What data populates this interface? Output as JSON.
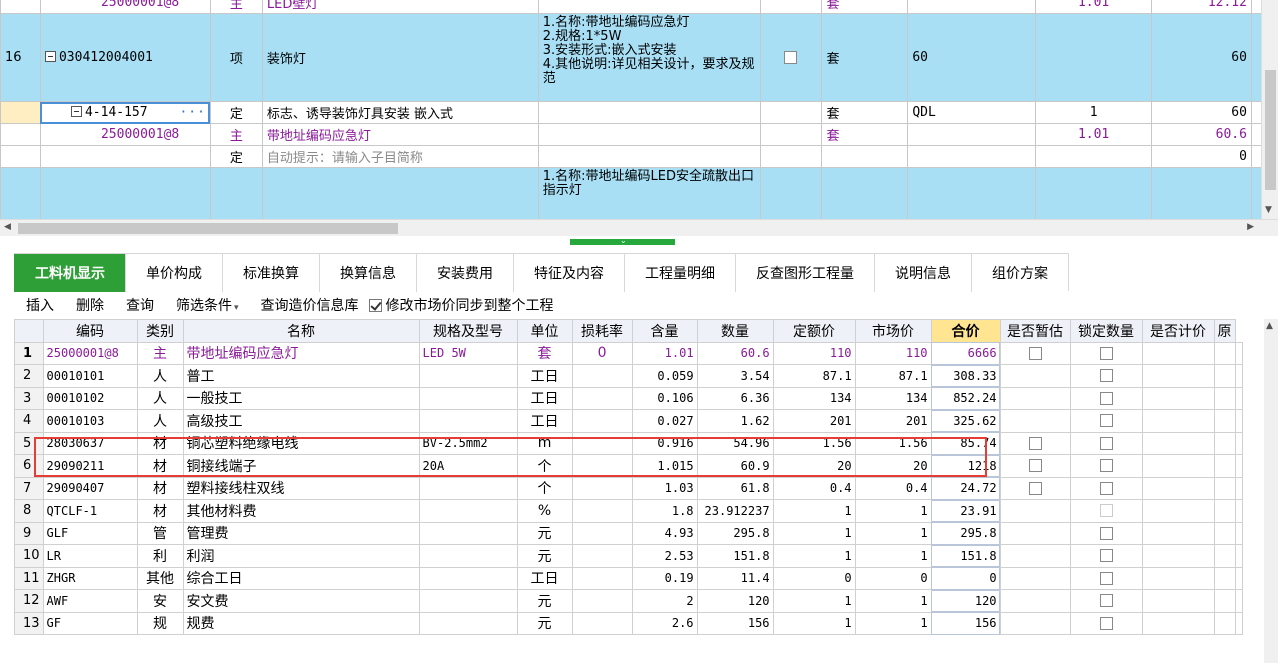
{
  "top_grid": {
    "rows": [
      {
        "rownum": "",
        "code": "25000001@8",
        "type": "主",
        "name": "LED壁灯",
        "features": "",
        "unit": "套",
        "qty_expr": "",
        "qty": "1.01",
        "price": "12.12"
      },
      {
        "rownum": "16",
        "code": "030412004001",
        "type": "项",
        "name": "装饰灯",
        "features": "1.名称:带地址编码应急灯\n2.规格:1*5W\n3.安装形式:嵌入式安装\n4.其他说明:详见相关设计，要求及规范",
        "unit": "套",
        "qty_expr": "60",
        "qty": "",
        "price": "60"
      },
      {
        "rownum": "",
        "code": "4-14-157",
        "type": "定",
        "name": "标志、诱导装饰灯具安装 嵌入式",
        "features": "",
        "unit": "套",
        "qty_expr": "QDL",
        "qty": "1",
        "price": "60"
      },
      {
        "rownum": "",
        "code": "25000001@8",
        "type": "主",
        "name": "带地址编码应急灯",
        "features": "",
        "unit": "套",
        "qty_expr": "",
        "qty": "1.01",
        "price": "60.6"
      },
      {
        "rownum": "",
        "code": "",
        "type": "定",
        "name": "自动提示：请输入子目简称",
        "features": "",
        "unit": "",
        "qty_expr": "",
        "qty": "",
        "price": "0"
      },
      {
        "rownum": "",
        "code": "",
        "type": "",
        "name": "",
        "features": "1.名称:带地址编码LED安全疏散出口指示灯",
        "unit": "",
        "qty_expr": "",
        "qty": "",
        "price": ""
      }
    ]
  },
  "tabs": [
    {
      "label": "工料机显示",
      "active": true
    },
    {
      "label": "单价构成"
    },
    {
      "label": "标准换算"
    },
    {
      "label": "换算信息"
    },
    {
      "label": "安装费用"
    },
    {
      "label": "特征及内容"
    },
    {
      "label": "工程量明细"
    },
    {
      "label": "反查图形工程量"
    },
    {
      "label": "说明信息"
    },
    {
      "label": "组价方案"
    }
  ],
  "toolbar": {
    "insert": "插入",
    "delete": "删除",
    "query": "查询",
    "filter": "筛选条件",
    "price_lib": "查询造价信息库",
    "sync_label": "修改市场价同步到整个工程"
  },
  "bottom_grid": {
    "headers": [
      "编码",
      "类别",
      "名称",
      "规格及型号",
      "单位",
      "损耗率",
      "含量",
      "数量",
      "定额价",
      "市场价",
      "合价",
      "是否暂估",
      "锁定数量",
      "是否计价",
      "原"
    ],
    "rows": [
      {
        "n": "1",
        "code": "25000001@8",
        "cat": "主",
        "name": "带地址编码应急灯",
        "spec": "LED 5W",
        "unit": "套",
        "loss": "0",
        "content": "1.01",
        "qty": "60.6",
        "quota": "110",
        "market": "110",
        "total": "6666"
      },
      {
        "n": "2",
        "code": "00010101",
        "cat": "人",
        "name": "普工",
        "spec": "",
        "unit": "工日",
        "loss": "",
        "content": "0.059",
        "qty": "3.54",
        "quota": "87.1",
        "market": "87.1",
        "total": "308.33"
      },
      {
        "n": "3",
        "code": "00010102",
        "cat": "人",
        "name": "一般技工",
        "spec": "",
        "unit": "工日",
        "loss": "",
        "content": "0.106",
        "qty": "6.36",
        "quota": "134",
        "market": "134",
        "total": "852.24"
      },
      {
        "n": "4",
        "code": "00010103",
        "cat": "人",
        "name": "高级技工",
        "spec": "",
        "unit": "工日",
        "loss": "",
        "content": "0.027",
        "qty": "1.62",
        "quota": "201",
        "market": "201",
        "total": "325.62"
      },
      {
        "n": "5",
        "code": "28030637",
        "cat": "材",
        "name": "铜芯塑料绝缘电线",
        "spec": "BV-2.5mm2",
        "unit": "m",
        "loss": "",
        "content": "0.916",
        "qty": "54.96",
        "quota": "1.56",
        "market": "1.56",
        "total": "85.74"
      },
      {
        "n": "6",
        "code": "29090211",
        "cat": "材",
        "name": "铜接线端子",
        "spec": "20A",
        "unit": "个",
        "loss": "",
        "content": "1.015",
        "qty": "60.9",
        "quota": "20",
        "market": "20",
        "total": "1218"
      },
      {
        "n": "7",
        "code": "29090407",
        "cat": "材",
        "name": "塑料接线柱双线",
        "spec": "",
        "unit": "个",
        "loss": "",
        "content": "1.03",
        "qty": "61.8",
        "quota": "0.4",
        "market": "0.4",
        "total": "24.72"
      },
      {
        "n": "8",
        "code": "QTCLF-1",
        "cat": "材",
        "name": "其他材料费",
        "spec": "",
        "unit": "%",
        "loss": "",
        "content": "1.8",
        "qty": "23.912237",
        "quota": "1",
        "market": "1",
        "total": "23.91"
      },
      {
        "n": "9",
        "code": "GLF",
        "cat": "管",
        "name": "管理费",
        "spec": "",
        "unit": "元",
        "loss": "",
        "content": "4.93",
        "qty": "295.8",
        "quota": "1",
        "market": "1",
        "total": "295.8"
      },
      {
        "n": "10",
        "code": "LR",
        "cat": "利",
        "name": "利润",
        "spec": "",
        "unit": "元",
        "loss": "",
        "content": "2.53",
        "qty": "151.8",
        "quota": "1",
        "market": "1",
        "total": "151.8"
      },
      {
        "n": "11",
        "code": "ZHGR",
        "cat": "其他",
        "name": "综合工日",
        "spec": "",
        "unit": "工日",
        "loss": "",
        "content": "0.19",
        "qty": "11.4",
        "quota": "0",
        "market": "0",
        "total": "0"
      },
      {
        "n": "12",
        "code": "AWF",
        "cat": "安",
        "name": "安文费",
        "spec": "",
        "unit": "元",
        "loss": "",
        "content": "2",
        "qty": "120",
        "quota": "1",
        "market": "1",
        "total": "120"
      },
      {
        "n": "13",
        "code": "GF",
        "cat": "规",
        "name": "规费",
        "spec": "",
        "unit": "元",
        "loss": "",
        "content": "2.6",
        "qty": "156",
        "quota": "1",
        "market": "1",
        "total": "156"
      }
    ]
  },
  "colors": {
    "accent": "#2e9f36",
    "selected_row": "#a9dff5",
    "highlight": "#e53d35",
    "main_text": "#8a1a9a"
  }
}
